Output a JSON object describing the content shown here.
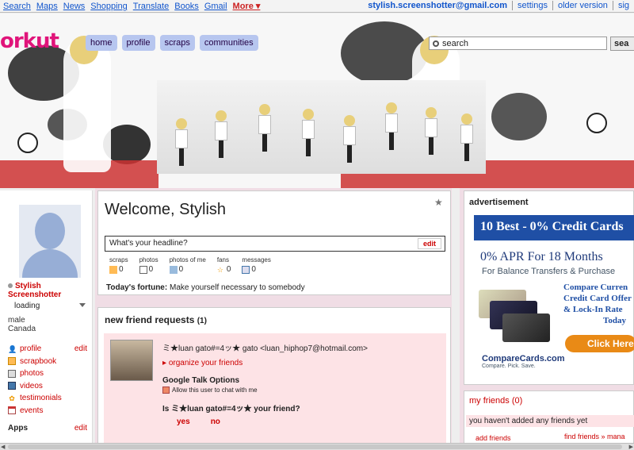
{
  "gbar": {
    "links": [
      "Search",
      "Maps",
      "News",
      "Shopping",
      "Translate",
      "Books",
      "Gmail"
    ],
    "more": "More ▾",
    "account": "stylish.screenshotter@gmail.com",
    "settings": "settings",
    "older": "older version",
    "signout": "sig"
  },
  "logo": "orkut",
  "nav": [
    "home",
    "profile",
    "scraps",
    "communities"
  ],
  "search": {
    "placeholder": "search",
    "button": "sea"
  },
  "profile": {
    "name_line1": "Stylish",
    "name_line2": "Screenshotter",
    "status": "loading",
    "gender": "male",
    "country": "Canada",
    "menu": [
      {
        "label": "profile",
        "icon": "person-icon",
        "edit": "edit"
      },
      {
        "label": "scrapbook",
        "icon": "scrapbook-icon",
        "edit": ""
      },
      {
        "label": "photos",
        "icon": "camera-icon",
        "edit": ""
      },
      {
        "label": "videos",
        "icon": "video-icon",
        "edit": ""
      },
      {
        "label": "testimonials",
        "icon": "testimonial-icon",
        "edit": ""
      },
      {
        "label": "events",
        "icon": "calendar-icon",
        "edit": ""
      }
    ],
    "apps": "Apps",
    "apps_edit": "edit"
  },
  "welcome": {
    "title": "Welcome, Stylish",
    "headline": "What's your headline?",
    "headline_edit": "edit",
    "stats": [
      {
        "label": "scraps",
        "value": "0",
        "icon": "scrap-icon"
      },
      {
        "label": "photos",
        "value": "0",
        "icon": "camera-icon"
      },
      {
        "label": "photos of me",
        "value": "0",
        "icon": "tag-icon"
      },
      {
        "label": "fans",
        "value": "0",
        "icon": "star-icon"
      },
      {
        "label": "messages",
        "value": "0",
        "icon": "envelope-icon"
      }
    ],
    "fortune_label": "Today's fortune:",
    "fortune": "Make yourself necessary to somebody"
  },
  "requests": {
    "title": "new friend requests",
    "count": "(1)",
    "requester": "ミ★luan gato#=4ッ★ gato <luan_hiphop7@hotmail.com>",
    "organize": "organize your friends",
    "gtalk_title": "Google Talk Options",
    "gtalk_check": "Allow this user to chat with me",
    "question": "Is ミ★luan gato#=4ッ★ your friend?",
    "yes": "yes",
    "no": "no"
  },
  "ad": {
    "title": "advertisement",
    "banner": "10 Best - 0% Credit Cards",
    "apr": "0% APR For 18 Months",
    "balance": "For Balance Transfers & Purchase",
    "compare_lines": [
      "Compare Curren",
      "Credit Card Offer",
      "& Lock-In Rate",
      "Today"
    ],
    "click": "Click Here",
    "brand": "CompareCards.com",
    "brand_tag": "Compare. Pick. Save."
  },
  "friends": {
    "title": "my friends",
    "count": "(0)",
    "none": "you haven't added any friends yet",
    "add": "add friends",
    "find": "find friends »  mana"
  }
}
